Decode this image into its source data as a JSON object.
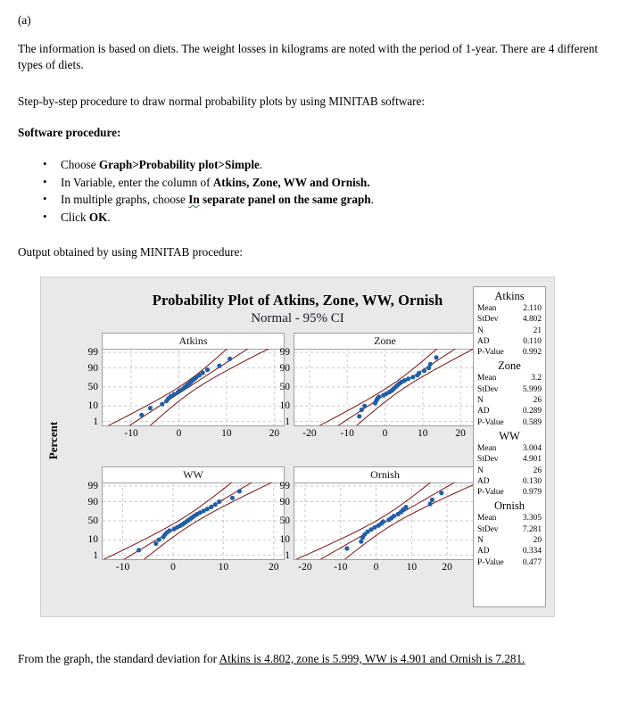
{
  "document": {
    "part_label": "(a)",
    "paragraph_1": "The information is based on diets. The weight losses in kilograms are noted with the period of 1-year. There are 4 different types of diets.",
    "paragraph_2": "Step-by-step procedure to draw normal probability plots by using MINITAB software:",
    "software_procedure_heading": "Software procedure:",
    "steps": [
      {
        "prefix": "Choose ",
        "bold": "Graph>Probability plot>Simple",
        "suffix": "."
      },
      {
        "prefix": "In Variable, enter the column of ",
        "bold": "Atkins, Zone, WW and Ornish.",
        "suffix": ""
      },
      {
        "prefix": "In multiple graphs, choose ",
        "bold_squiggle": "In",
        "bold": " separate panel on the same graph",
        "suffix": "."
      },
      {
        "prefix": "Click ",
        "bold": "OK",
        "suffix": "."
      }
    ],
    "output_line": "Output obtained by using MINITAB procedure:",
    "conclusion_plain": "From the graph, the standard deviation for ",
    "conclusion_underlined": "Atkins is 4.802, zone is 5.999, WW is 4.901 and Ornish is 7.281."
  },
  "chart_data": {
    "type": "scatter",
    "title": "Probability Plot of Atkins, Zone, WW, Ornish",
    "subtitle": "Normal - 95% CI",
    "ylabel": "Percent",
    "xlabel": "",
    "grid": true,
    "legend_position": "right",
    "yticks": [
      "99",
      "90",
      "50",
      "10",
      "1"
    ],
    "ytick_percents": [
      99,
      90,
      50,
      10,
      1
    ],
    "colors": {
      "point": "#1f5fa8",
      "fit_line": "#7b1212",
      "ci_line": "#7b1212",
      "grid": "#c9c9c9",
      "panel_bg": "#ffffff",
      "graph_bg": "#e9e9e9"
    },
    "panels": [
      {
        "name": "Atkins",
        "xticks": [
          "-10",
          "0",
          "10",
          "20"
        ],
        "xtick_values": [
          -10,
          0,
          10,
          20
        ],
        "xlim": [
          -16,
          22
        ],
        "mean": 2.11,
        "stdev": 4.802,
        "n": 21,
        "values": [
          -7.8,
          -6.0,
          -3.5,
          -2.6,
          -2.2,
          -1.7,
          -1.0,
          -0.2,
          0.2,
          0.9,
          1.3,
          1.7,
          2.2,
          2.6,
          3.1,
          3.6,
          4.3,
          5.0,
          6.0,
          8.5,
          10.7
        ]
      },
      {
        "name": "Zone",
        "xticks": [
          "-20",
          "-10",
          "0",
          "10",
          "20"
        ],
        "xtick_values": [
          -20,
          -10,
          0,
          10,
          20
        ],
        "xlim": [
          -24,
          24
        ],
        "mean": 3.2,
        "stdev": 5.999,
        "n": 26,
        "values": [
          -6.8,
          -6.2,
          -5.4,
          -2.6,
          -2.3,
          -2.0,
          -1.6,
          -0.4,
          0.4,
          1.2,
          1.8,
          2.2,
          2.6,
          3.0,
          3.4,
          3.8,
          4.4,
          5.2,
          6.2,
          7.4,
          8.6,
          9.0,
          10.4,
          11.6,
          12.0,
          13.6
        ]
      },
      {
        "name": "WW",
        "xticks": [
          "-10",
          "0",
          "10",
          "20"
        ],
        "xtick_values": [
          -10,
          0,
          10,
          20
        ],
        "xlim": [
          -14,
          22
        ],
        "mean": 3.004,
        "stdev": 4.901,
        "n": 26,
        "values": [
          -6.8,
          -3.4,
          -2.8,
          -1.9,
          -1.6,
          -1.2,
          -0.7,
          0.2,
          0.8,
          1.4,
          1.9,
          2.3,
          2.7,
          3.1,
          3.5,
          3.9,
          4.3,
          4.8,
          5.4,
          6.1,
          6.8,
          7.6,
          8.4,
          9.2,
          11.8,
          13.2
        ]
      },
      {
        "name": "Ornish",
        "xticks": [
          "-20",
          "-10",
          "0",
          "10",
          "20"
        ],
        "xtick_values": [
          -20,
          -10,
          0,
          10,
          20
        ],
        "xlim": [
          -23,
          28
        ],
        "mean": 3.305,
        "stdev": 7.281,
        "n": 20,
        "values": [
          -8.2,
          -4.2,
          -3.8,
          -3.2,
          -2.4,
          -1.4,
          -0.4,
          0.7,
          1.5,
          2.0,
          3.6,
          4.3,
          5.0,
          6.2,
          7.0,
          7.6,
          8.4,
          15.2,
          15.8,
          18.4
        ]
      }
    ],
    "legend": {
      "groups": [
        {
          "name": "Atkins",
          "rows": [
            {
              "key": "Mean",
              "value": "2.110"
            },
            {
              "key": "StDev",
              "value": "4.802"
            },
            {
              "key": "N",
              "value": "21"
            },
            {
              "key": "AD",
              "value": "0.110"
            },
            {
              "key": "P-Value",
              "value": "0.992"
            }
          ]
        },
        {
          "name": "Zone",
          "rows": [
            {
              "key": "Mean",
              "value": "3.2"
            },
            {
              "key": "StDev",
              "value": "5.999"
            },
            {
              "key": "N",
              "value": "26"
            },
            {
              "key": "AD",
              "value": "0.289"
            },
            {
              "key": "P-Value",
              "value": "0.589"
            }
          ]
        },
        {
          "name": "WW",
          "rows": [
            {
              "key": "Mean",
              "value": "3.004"
            },
            {
              "key": "StDev",
              "value": "4.901"
            },
            {
              "key": "N",
              "value": "26"
            },
            {
              "key": "AD",
              "value": "0.130"
            },
            {
              "key": "P-Value",
              "value": "0.979"
            }
          ]
        },
        {
          "name": "Ornish",
          "rows": [
            {
              "key": "Mean",
              "value": "3.305"
            },
            {
              "key": "StDev",
              "value": "7.281"
            },
            {
              "key": "N",
              "value": "20"
            },
            {
              "key": "AD",
              "value": "0.334"
            },
            {
              "key": "P-Value",
              "value": "0.477"
            }
          ]
        }
      ]
    }
  }
}
